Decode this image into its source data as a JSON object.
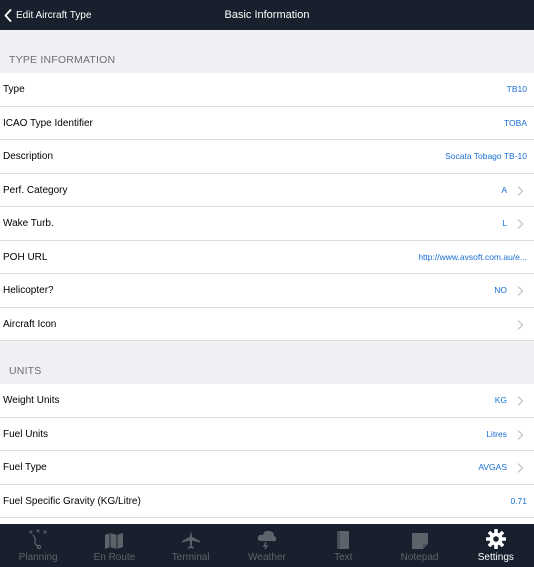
{
  "nav": {
    "back_label": "Edit Aircraft Type",
    "title": "Basic Information"
  },
  "sections": [
    {
      "header": "TYPE INFORMATION",
      "rows": [
        {
          "label": "Type",
          "value": "TB10",
          "chevron": false
        },
        {
          "label": "ICAO Type Identifier",
          "value": "TOBA",
          "chevron": false
        },
        {
          "label": "Description",
          "value": "Socata Tobago TB-10",
          "chevron": false
        },
        {
          "label": "Perf. Category",
          "value": "A",
          "chevron": true
        },
        {
          "label": "Wake Turb.",
          "value": "L",
          "chevron": true
        },
        {
          "label": "POH URL",
          "value": "http://www.avsoft.com.au/e...",
          "chevron": false
        },
        {
          "label": "Helicopter?",
          "value": "NO",
          "chevron": true
        },
        {
          "label": "Aircraft Icon",
          "value": "",
          "chevron": true
        }
      ]
    },
    {
      "header": "UNITS",
      "rows": [
        {
          "label": "Weight Units",
          "value": "KG",
          "chevron": true
        },
        {
          "label": "Fuel Units",
          "value": "Litres",
          "chevron": true
        },
        {
          "label": "Fuel Type",
          "value": "AVGAS",
          "chevron": true
        },
        {
          "label": "Fuel Specific Gravity (KG/Litre)",
          "value": "0.71",
          "chevron": false
        }
      ]
    }
  ],
  "tabs": [
    {
      "label": "Planning",
      "icon": "planning-icon",
      "active": false
    },
    {
      "label": "En Route",
      "icon": "map-icon",
      "active": false
    },
    {
      "label": "Terminal",
      "icon": "airplane-icon",
      "active": false
    },
    {
      "label": "Weather",
      "icon": "weather-icon",
      "active": false
    },
    {
      "label": "Text",
      "icon": "document-icon",
      "active": false
    },
    {
      "label": "Notepad",
      "icon": "notepad-icon",
      "active": false
    },
    {
      "label": "Settings",
      "icon": "gear-icon",
      "active": true
    }
  ],
  "colors": {
    "accent": "#1a6fd4",
    "bar": "#17202c",
    "active_tab": "#ffffff",
    "inactive_tab": "#5d636b"
  }
}
